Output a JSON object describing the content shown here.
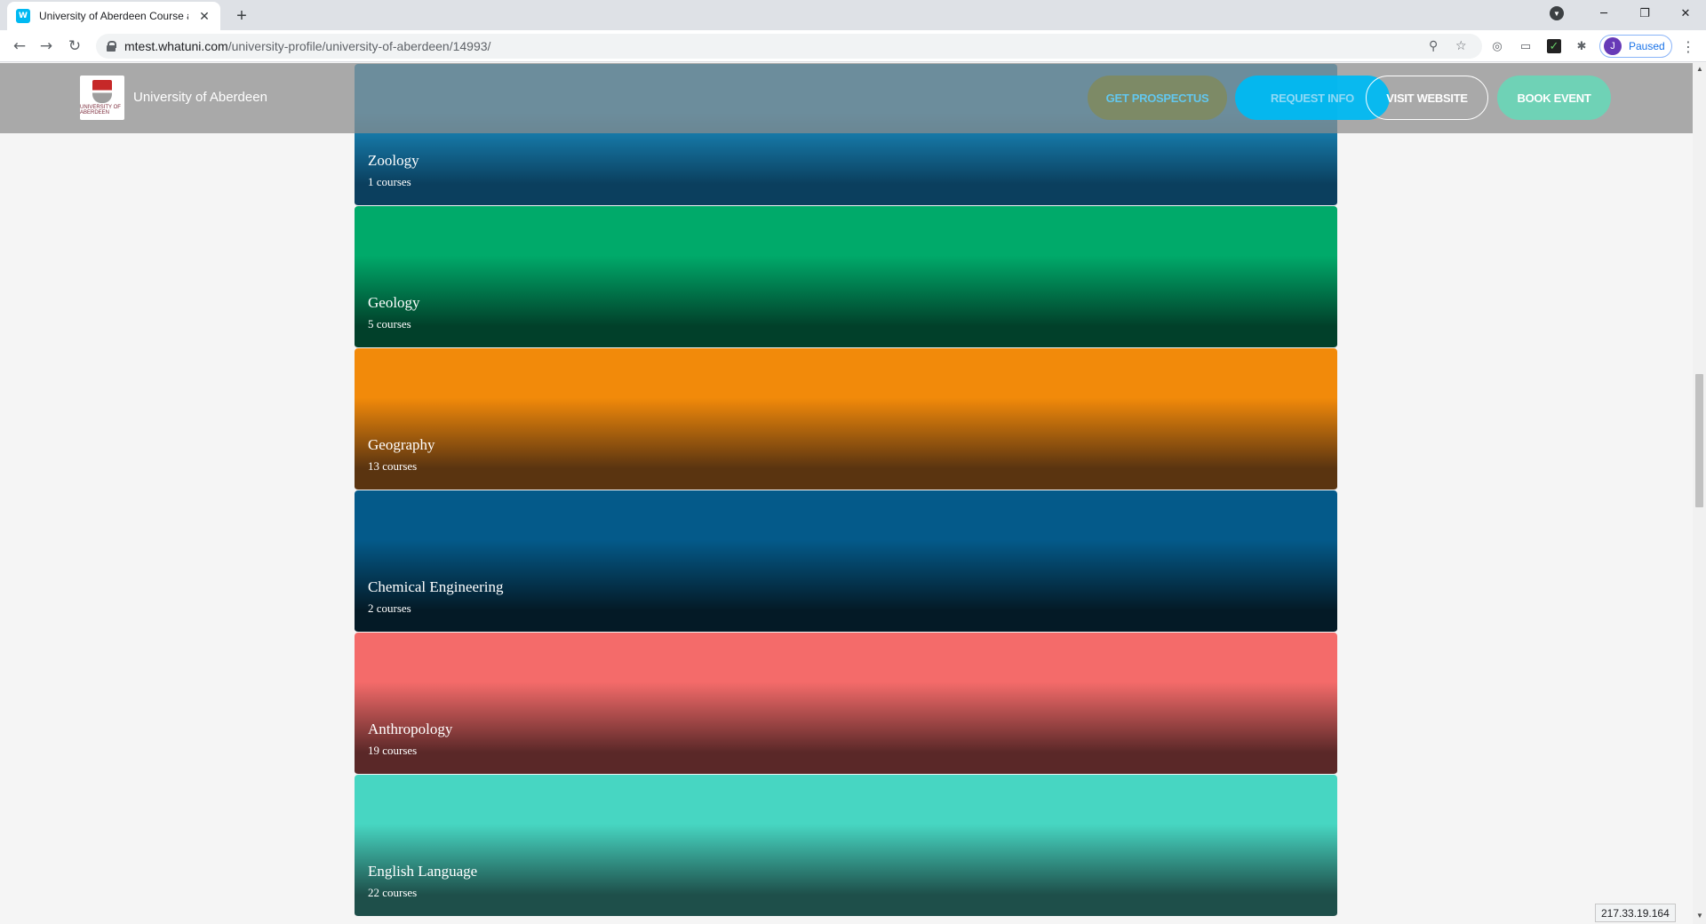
{
  "browser": {
    "tab_title": "University of Aberdeen Course and University Information",
    "favicon_text": "W",
    "url_host": "mtest.whatuni.com",
    "url_path": "/university-profile/university-of-aberdeen/14993/",
    "profile_initial": "J",
    "profile_status": "Paused",
    "status_ip": "217.33.19.164"
  },
  "header": {
    "university_name": "University of Aberdeen",
    "logo_text": "UNIVERSITY OF ABERDEEN",
    "buttons": {
      "prospectus": "GET PROSPECTUS",
      "request_info": "REQUEST INFO",
      "visit_website": "VISIT WEBSITE",
      "book_event": "BOOK EVENT"
    }
  },
  "subjects": [
    {
      "name": "Zoology",
      "count": "1 courses",
      "color_top": "#1a8fc4",
      "color_bottom": "#0b3f5e"
    },
    {
      "name": "Geology",
      "count": "5 courses",
      "color_top": "#00aa6a",
      "color_bottom": "#01402a"
    },
    {
      "name": "Geography",
      "count": "13 courses",
      "color_top": "#f28a0a",
      "color_bottom": "#5a3410"
    },
    {
      "name": "Chemical Engineering",
      "count": "2 courses",
      "color_top": "#045a8a",
      "color_bottom": "#041a26"
    },
    {
      "name": "Anthropology",
      "count": "19 courses",
      "color_top": "#f46b6a",
      "color_bottom": "#5a2828"
    },
    {
      "name": "English Language",
      "count": "22 courses",
      "color_top": "#47d6c2",
      "color_bottom": "#1e4f4a"
    }
  ]
}
